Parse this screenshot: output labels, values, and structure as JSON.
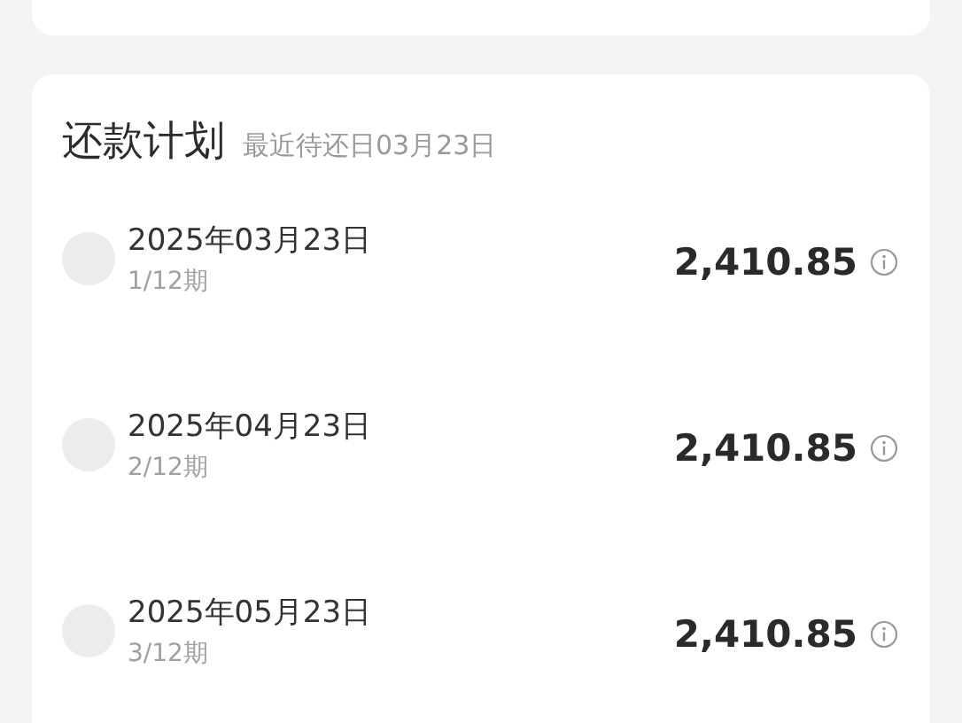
{
  "plan": {
    "title": "还款计划",
    "subtitle": "最近待还日03月23日",
    "installments": [
      {
        "date": "2025年03月23日",
        "period": "1/12期",
        "amount": "2,410.85"
      },
      {
        "date": "2025年04月23日",
        "period": "2/12期",
        "amount": "2,410.85"
      },
      {
        "date": "2025年05月23日",
        "period": "3/12期",
        "amount": "2,410.85"
      }
    ]
  }
}
